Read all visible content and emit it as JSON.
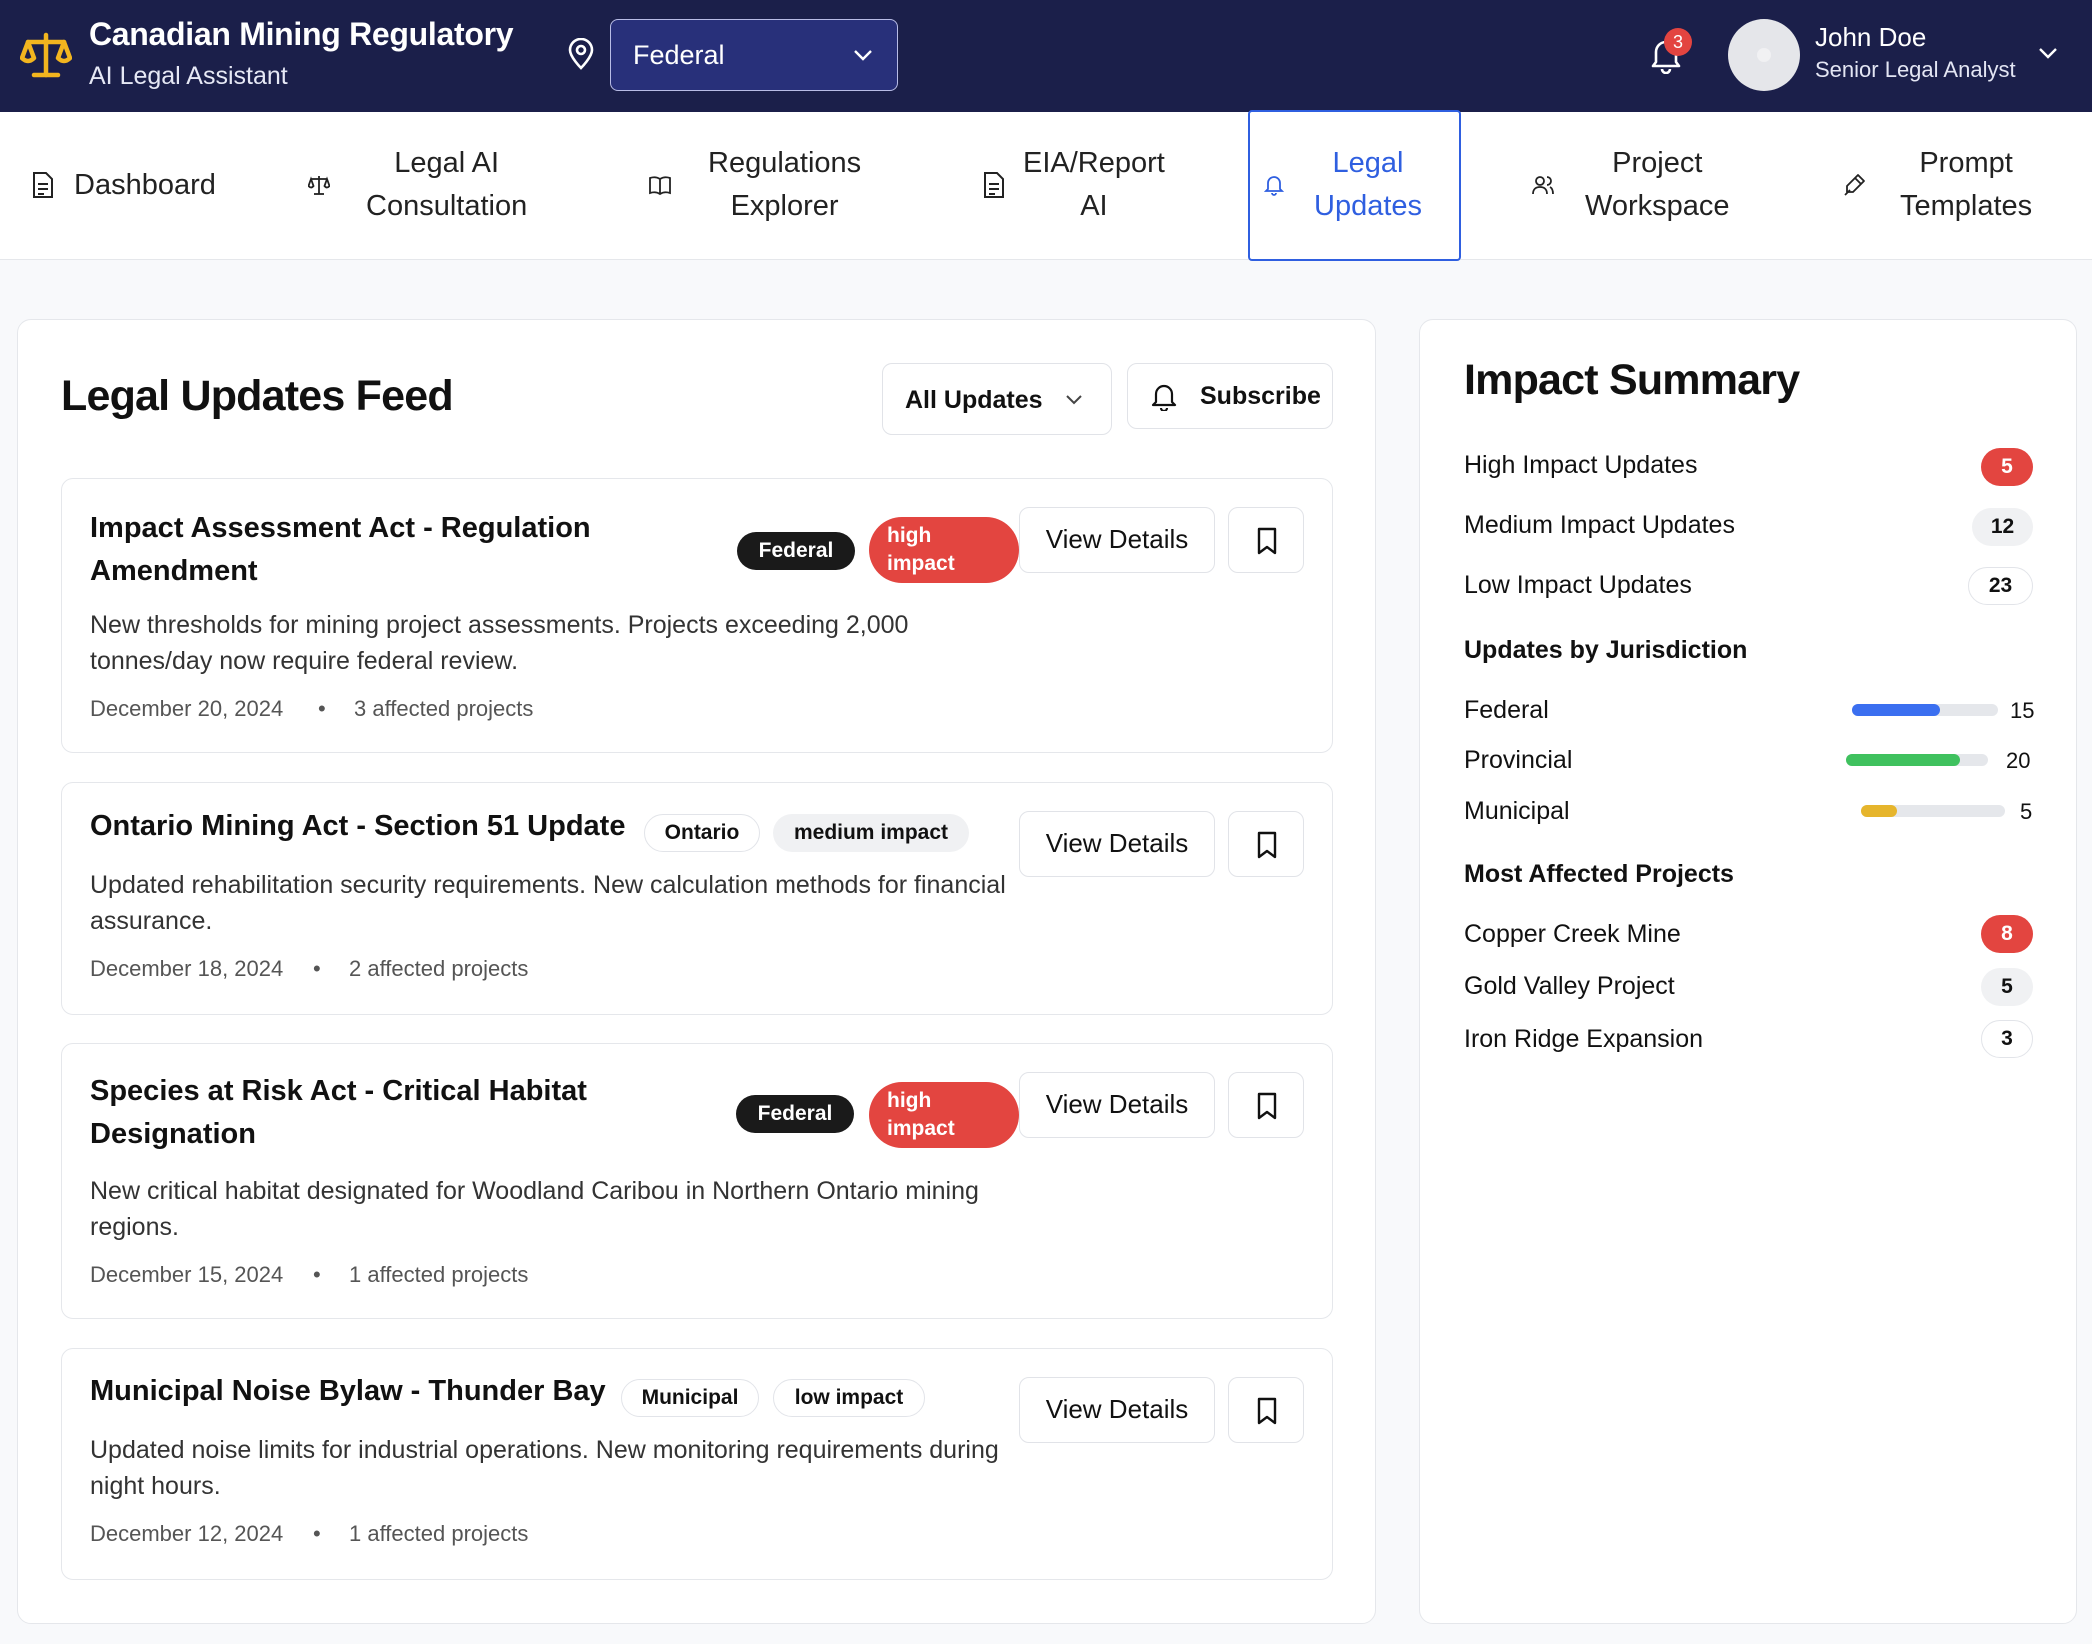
{
  "header": {
    "title": "Canadian Mining Regulatory",
    "subtitle": "AI Legal Assistant",
    "jurisdiction_selected": "Federal",
    "notifications_count": "3",
    "user_name": "John Doe",
    "user_role": "Senior Legal Analyst"
  },
  "tabs": [
    {
      "label": "Dashboard",
      "icon": "document-icon"
    },
    {
      "label": "Legal AI\nConsultation",
      "icon": "scale-icon"
    },
    {
      "label": "Regulations\nExplorer",
      "icon": "book-icon"
    },
    {
      "label": "EIA/Report\nAI",
      "icon": "document-icon"
    },
    {
      "label": "Legal\nUpdates",
      "icon": "bell-icon",
      "active": true
    },
    {
      "label": "Project\nWorkspace",
      "icon": "users-icon"
    },
    {
      "label": "Prompt\nTemplates",
      "icon": "pen-icon"
    }
  ],
  "feed": {
    "title": "Legal Updates Feed",
    "filter_value": "All Updates",
    "subscribe_label": "Subscribe",
    "view_details_label": "View Details",
    "updates": [
      {
        "title": "Impact Assessment Act - Regulation Amendment",
        "jurisdiction": "Federal",
        "impact": "high impact",
        "description": "New thresholds for mining project assessments. Projects exceeding 2,000 tonnes/day now require federal review.",
        "date": "December 20, 2024",
        "affected": "3 affected projects"
      },
      {
        "title": "Ontario Mining Act - Section 51 Update",
        "jurisdiction": "Ontario",
        "impact": "medium impact",
        "description": "Updated rehabilitation security requirements. New calculation methods for financial assurance.",
        "date": "December 18, 2024",
        "affected": "2 affected projects"
      },
      {
        "title": "Species at Risk Act - Critical Habitat Designation",
        "jurisdiction": "Federal",
        "impact": "high impact",
        "description": "New critical habitat designated for Woodland Caribou in Northern Ontario mining regions.",
        "date": "December 15, 2024",
        "affected": "1 affected projects"
      },
      {
        "title": "Municipal Noise Bylaw - Thunder Bay",
        "jurisdiction": "Municipal",
        "impact": "low impact",
        "description": "Updated noise limits for industrial operations. New monitoring requirements during night hours.",
        "date": "December 12, 2024",
        "affected": "1 affected projects"
      }
    ]
  },
  "summary": {
    "title": "Impact Summary",
    "impact_rows": [
      {
        "label": "High Impact Updates",
        "count": "5"
      },
      {
        "label": "Medium Impact Updates",
        "count": "12"
      },
      {
        "label": "Low Impact Updates",
        "count": "23"
      }
    ],
    "jurisdiction_heading": "Updates by Jurisdiction",
    "jurisdictions": [
      {
        "label": "Federal",
        "count": "15",
        "fill_fraction": 0.6,
        "color": "#3b6ff0"
      },
      {
        "label": "Provincial",
        "count": "20",
        "fill_fraction": 0.8,
        "color": "#3fc15e"
      },
      {
        "label": "Municipal",
        "count": "5",
        "fill_fraction": 0.25,
        "color": "#e6b52c"
      }
    ],
    "projects_heading": "Most Affected Projects",
    "projects": [
      {
        "label": "Copper Creek Mine",
        "count": "8"
      },
      {
        "label": "Gold Valley Project",
        "count": "5"
      },
      {
        "label": "Iron Ridge Expansion",
        "count": "3"
      }
    ]
  },
  "colors": {
    "header_bg": "#1b1f4a",
    "accent": "#2f5fe0",
    "danger": "#e34540"
  }
}
